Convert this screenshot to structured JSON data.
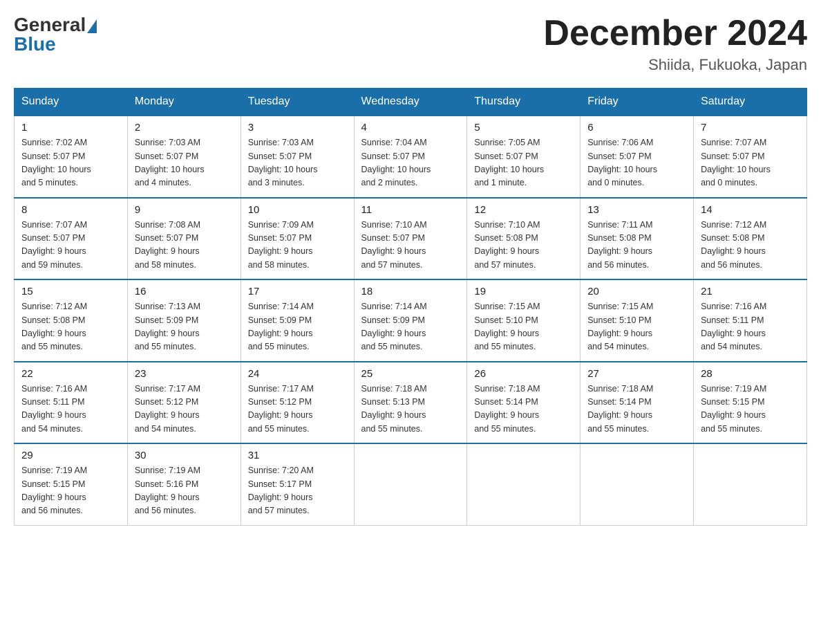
{
  "header": {
    "logo_general": "General",
    "logo_blue": "Blue",
    "month_title": "December 2024",
    "subtitle": "Shiida, Fukuoka, Japan"
  },
  "weekdays": [
    "Sunday",
    "Monday",
    "Tuesday",
    "Wednesday",
    "Thursday",
    "Friday",
    "Saturday"
  ],
  "weeks": [
    [
      {
        "day": "1",
        "sunrise": "7:02 AM",
        "sunset": "5:07 PM",
        "daylight": "10 hours and 5 minutes."
      },
      {
        "day": "2",
        "sunrise": "7:03 AM",
        "sunset": "5:07 PM",
        "daylight": "10 hours and 4 minutes."
      },
      {
        "day": "3",
        "sunrise": "7:03 AM",
        "sunset": "5:07 PM",
        "daylight": "10 hours and 3 minutes."
      },
      {
        "day": "4",
        "sunrise": "7:04 AM",
        "sunset": "5:07 PM",
        "daylight": "10 hours and 2 minutes."
      },
      {
        "day": "5",
        "sunrise": "7:05 AM",
        "sunset": "5:07 PM",
        "daylight": "10 hours and 1 minute."
      },
      {
        "day": "6",
        "sunrise": "7:06 AM",
        "sunset": "5:07 PM",
        "daylight": "10 hours and 0 minutes."
      },
      {
        "day": "7",
        "sunrise": "7:07 AM",
        "sunset": "5:07 PM",
        "daylight": "10 hours and 0 minutes."
      }
    ],
    [
      {
        "day": "8",
        "sunrise": "7:07 AM",
        "sunset": "5:07 PM",
        "daylight": "9 hours and 59 minutes."
      },
      {
        "day": "9",
        "sunrise": "7:08 AM",
        "sunset": "5:07 PM",
        "daylight": "9 hours and 58 minutes."
      },
      {
        "day": "10",
        "sunrise": "7:09 AM",
        "sunset": "5:07 PM",
        "daylight": "9 hours and 58 minutes."
      },
      {
        "day": "11",
        "sunrise": "7:10 AM",
        "sunset": "5:07 PM",
        "daylight": "9 hours and 57 minutes."
      },
      {
        "day": "12",
        "sunrise": "7:10 AM",
        "sunset": "5:08 PM",
        "daylight": "9 hours and 57 minutes."
      },
      {
        "day": "13",
        "sunrise": "7:11 AM",
        "sunset": "5:08 PM",
        "daylight": "9 hours and 56 minutes."
      },
      {
        "day": "14",
        "sunrise": "7:12 AM",
        "sunset": "5:08 PM",
        "daylight": "9 hours and 56 minutes."
      }
    ],
    [
      {
        "day": "15",
        "sunrise": "7:12 AM",
        "sunset": "5:08 PM",
        "daylight": "9 hours and 55 minutes."
      },
      {
        "day": "16",
        "sunrise": "7:13 AM",
        "sunset": "5:09 PM",
        "daylight": "9 hours and 55 minutes."
      },
      {
        "day": "17",
        "sunrise": "7:14 AM",
        "sunset": "5:09 PM",
        "daylight": "9 hours and 55 minutes."
      },
      {
        "day": "18",
        "sunrise": "7:14 AM",
        "sunset": "5:09 PM",
        "daylight": "9 hours and 55 minutes."
      },
      {
        "day": "19",
        "sunrise": "7:15 AM",
        "sunset": "5:10 PM",
        "daylight": "9 hours and 55 minutes."
      },
      {
        "day": "20",
        "sunrise": "7:15 AM",
        "sunset": "5:10 PM",
        "daylight": "9 hours and 54 minutes."
      },
      {
        "day": "21",
        "sunrise": "7:16 AM",
        "sunset": "5:11 PM",
        "daylight": "9 hours and 54 minutes."
      }
    ],
    [
      {
        "day": "22",
        "sunrise": "7:16 AM",
        "sunset": "5:11 PM",
        "daylight": "9 hours and 54 minutes."
      },
      {
        "day": "23",
        "sunrise": "7:17 AM",
        "sunset": "5:12 PM",
        "daylight": "9 hours and 54 minutes."
      },
      {
        "day": "24",
        "sunrise": "7:17 AM",
        "sunset": "5:12 PM",
        "daylight": "9 hours and 55 minutes."
      },
      {
        "day": "25",
        "sunrise": "7:18 AM",
        "sunset": "5:13 PM",
        "daylight": "9 hours and 55 minutes."
      },
      {
        "day": "26",
        "sunrise": "7:18 AM",
        "sunset": "5:14 PM",
        "daylight": "9 hours and 55 minutes."
      },
      {
        "day": "27",
        "sunrise": "7:18 AM",
        "sunset": "5:14 PM",
        "daylight": "9 hours and 55 minutes."
      },
      {
        "day": "28",
        "sunrise": "7:19 AM",
        "sunset": "5:15 PM",
        "daylight": "9 hours and 55 minutes."
      }
    ],
    [
      {
        "day": "29",
        "sunrise": "7:19 AM",
        "sunset": "5:15 PM",
        "daylight": "9 hours and 56 minutes."
      },
      {
        "day": "30",
        "sunrise": "7:19 AM",
        "sunset": "5:16 PM",
        "daylight": "9 hours and 56 minutes."
      },
      {
        "day": "31",
        "sunrise": "7:20 AM",
        "sunset": "5:17 PM",
        "daylight": "9 hours and 57 minutes."
      },
      null,
      null,
      null,
      null
    ]
  ],
  "labels": {
    "sunrise": "Sunrise:",
    "sunset": "Sunset:",
    "daylight": "Daylight:"
  }
}
